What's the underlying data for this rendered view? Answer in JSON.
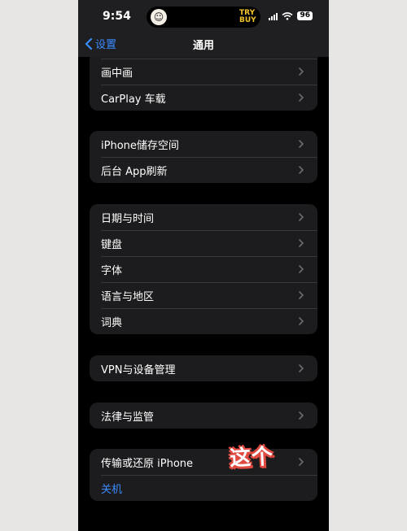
{
  "status": {
    "time": "9:54",
    "island_art": "TRY BUY",
    "battery": "96"
  },
  "nav": {
    "back_label": "设置",
    "title": "通用"
  },
  "groups": [
    {
      "items": [
        {
          "label": "画中画"
        },
        {
          "label": "CarPlay 车载"
        }
      ]
    },
    {
      "items": [
        {
          "label": "iPhone储存空间"
        },
        {
          "label": "后台 App刷新"
        }
      ]
    },
    {
      "items": [
        {
          "label": "日期与时间"
        },
        {
          "label": "键盘"
        },
        {
          "label": "字体"
        },
        {
          "label": "语言与地区"
        },
        {
          "label": "词典"
        }
      ]
    },
    {
      "items": [
        {
          "label": "VPN与设备管理"
        }
      ]
    },
    {
      "items": [
        {
          "label": "法律与监管"
        }
      ]
    },
    {
      "items": [
        {
          "label": "传输或还原 iPhone"
        },
        {
          "label": "关机"
        }
      ]
    }
  ],
  "sticker": {
    "text": "这个"
  },
  "colors": {
    "accent": "#3a8cff",
    "cell": "#1c1c1e",
    "background": "#000000",
    "sticker_outline": "#e04a40"
  },
  "icons": {
    "back": "chevron-left-icon",
    "row": "chevron-right-icon",
    "wifi": "wifi-icon",
    "signal": "signal-icon"
  }
}
